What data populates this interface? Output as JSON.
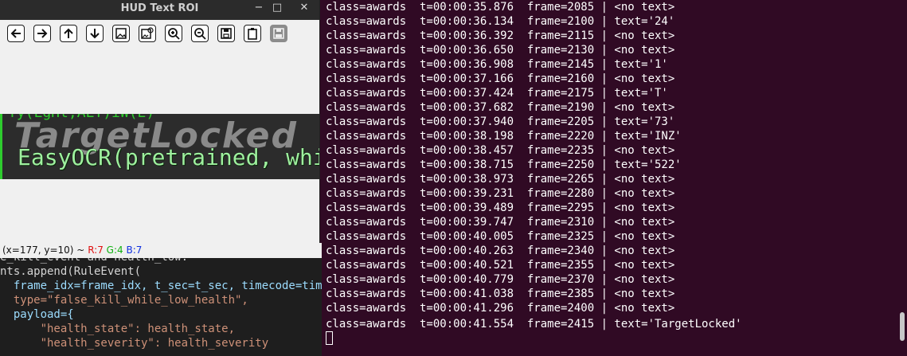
{
  "window": {
    "title": "HUD Text ROI",
    "minimize": "−",
    "maximize": "□",
    "close": "✕"
  },
  "toolbar": {
    "buttons": [
      {
        "name": "pan-left",
        "icon": "arrow-left-icon"
      },
      {
        "name": "pan-right",
        "icon": "arrow-right-icon"
      },
      {
        "name": "pan-up",
        "icon": "arrow-up-icon"
      },
      {
        "name": "pan-down",
        "icon": "arrow-down-icon"
      },
      {
        "name": "zoom-image",
        "icon": "image-icon"
      },
      {
        "name": "zoom-fit",
        "icon": "image-zoom-icon"
      },
      {
        "name": "zoom-in",
        "icon": "zoom-in-icon"
      },
      {
        "name": "zoom-out",
        "icon": "zoom-out-icon"
      },
      {
        "name": "save-image",
        "icon": "save-icon"
      },
      {
        "name": "copy-clipboard",
        "icon": "clipboard-icon"
      },
      {
        "name": "properties",
        "icon": "properties-icon"
      }
    ]
  },
  "roi": {
    "top_text": "Ty(LgHt,ALT)iW(E)",
    "shadow_text": "TargetLocked",
    "ocr_text": "EasyOCR(pretrained, whi"
  },
  "status": {
    "coords": "(x=177, y=10) ~",
    "r": "R:7",
    "g": "G:4",
    "b": "B:7"
  },
  "editor": {
    "lines": [
      "e_kill_event and health_low:",
      "nts.append(RuleEvent(",
      "  frame_idx=frame_idx, t_sec=t_sec, timecode=timec",
      "  type=\"false_kill_while_low_health\",",
      "  payload={",
      "      \"health_state\": health_state,",
      "      \"health_severity\": health_severity"
    ]
  },
  "terminal": {
    "lines": [
      "class=awards  t=00:00:35.876  frame=2085 | <no text>",
      "class=awards  t=00:00:36.134  frame=2100 | text='24'",
      "class=awards  t=00:00:36.392  frame=2115 | <no text>",
      "class=awards  t=00:00:36.650  frame=2130 | <no text>",
      "class=awards  t=00:00:36.908  frame=2145 | text='1'",
      "class=awards  t=00:00:37.166  frame=2160 | <no text>",
      "class=awards  t=00:00:37.424  frame=2175 | text='T'",
      "class=awards  t=00:00:37.682  frame=2190 | <no text>",
      "class=awards  t=00:00:37.940  frame=2205 | text='73'",
      "class=awards  t=00:00:38.198  frame=2220 | text='INZ'",
      "class=awards  t=00:00:38.457  frame=2235 | <no text>",
      "class=awards  t=00:00:38.715  frame=2250 | text='522'",
      "class=awards  t=00:00:38.973  frame=2265 | <no text>",
      "class=awards  t=00:00:39.231  frame=2280 | <no text>",
      "class=awards  t=00:00:39.489  frame=2295 | <no text>",
      "class=awards  t=00:00:39.747  frame=2310 | <no text>",
      "class=awards  t=00:00:40.005  frame=2325 | <no text>",
      "class=awards  t=00:00:40.263  frame=2340 | <no text>",
      "class=awards  t=00:00:40.521  frame=2355 | <no text>",
      "class=awards  t=00:00:40.779  frame=2370 | <no text>",
      "class=awards  t=00:00:41.038  frame=2385 | <no text>",
      "class=awards  t=00:00:41.296  frame=2400 | <no text>",
      "class=awards  t=00:00:41.554  frame=2415 | text='TargetLocked'"
    ]
  },
  "colors": {
    "terminal_bg": "#300a24",
    "editor_bg": "#1e1e1e",
    "hud_green": "#2ecc2e"
  }
}
